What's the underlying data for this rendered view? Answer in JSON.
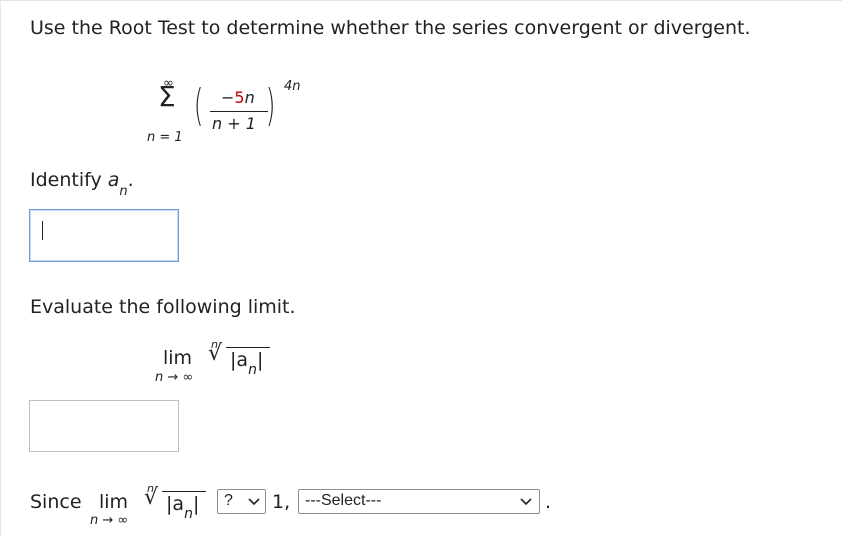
{
  "question": {
    "prompt": "Use the Root Test to determine whether the series convergent or divergent."
  },
  "series": {
    "sigma": "Σ",
    "upper": "∞",
    "lower": "n = 1",
    "numerator_sign": "−",
    "numerator_coef": "5",
    "numerator_var": "n",
    "denominator": "n + 1",
    "left_paren": "(",
    "right_paren": ")",
    "exponent": "4n"
  },
  "identify": {
    "label": "Identify ",
    "symbol": "a",
    "subscript": "n",
    "suffix": ".",
    "answer_value": ""
  },
  "evaluate": {
    "label": "Evaluate the following limit.",
    "lim": "lim",
    "lim_sub": "n → ∞",
    "root_index": "n",
    "radical": "√",
    "abs_open": "|",
    "a": "a",
    "a_sub": "n",
    "abs_close": "|",
    "answer_value": ""
  },
  "conclusion": {
    "since": "Since",
    "lim": "lim",
    "lim_sub": "n → ∞",
    "root_index": "n",
    "radical": "√",
    "abs_open": "|",
    "a": "a",
    "a_sub": "n",
    "abs_close": "|",
    "compare_selected": "?",
    "one": "1,",
    "result_selected": "---Select---",
    "period": "."
  },
  "colors": {
    "numerator_coef": "#c00000",
    "focus_border": "#6f9ad6"
  }
}
